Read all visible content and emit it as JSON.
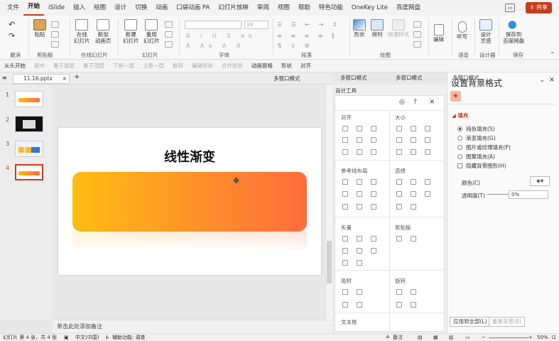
{
  "menu": {
    "items": [
      "文件",
      "开始",
      "iSlide",
      "插入",
      "绘图",
      "设计",
      "切换",
      "动画",
      "口袋动画 PA",
      "幻灯片放映",
      "审阅",
      "视图",
      "帮助",
      "特色功能",
      "OneKey Lite",
      "百度网盘"
    ],
    "share": "共享"
  },
  "ribbon": {
    "undo_label": "撤消",
    "paste": "粘贴",
    "clipboard": "剪贴板",
    "new_slide": "在线\n幻灯片",
    "new_anim": "新加\n动画页",
    "online_group": "在线幻灯片",
    "newslide": "新建\n幻灯片",
    "reuse": "重用\n幻灯片",
    "slides_group": "幻灯片",
    "font_size": "18",
    "font_group": "字体",
    "para_group": "段落",
    "shape": "形状",
    "arrange": "排列",
    "quick_style": "快速样式",
    "draw_group": "绘图",
    "edit": "编辑",
    "listen": "听写",
    "voice_group": "语音",
    "designer": "设计\n灵感",
    "designer_group": "设计器",
    "save_baidu": "保存到\n百度网盘",
    "save_group": "保存"
  },
  "quickbar": {
    "items": [
      {
        "label": "从头开始",
        "on": true
      },
      {
        "label": "居中",
        "on": false
      },
      {
        "label": "置于底层",
        "on": false
      },
      {
        "label": "置于顶层",
        "on": false
      },
      {
        "label": "下移一层",
        "on": false
      },
      {
        "label": "上移一层",
        "on": false
      },
      {
        "label": "旋转",
        "on": false
      },
      {
        "label": "编辑形状",
        "on": false
      },
      {
        "label": "合并形状",
        "on": false
      },
      {
        "label": "动画窗格",
        "on": true
      },
      {
        "label": "形状",
        "on": true
      },
      {
        "label": "对齐",
        "on": true
      }
    ]
  },
  "tabs": {
    "doc": "11.16.pptx",
    "win": [
      "多窗口模式",
      "多窗口模式",
      "多窗口模式",
      "多窗口模式"
    ]
  },
  "thumbs": [
    "1",
    "2",
    "3",
    "4"
  ],
  "slide": {
    "title": "线性渐变"
  },
  "notes": "单击此处添加备注",
  "dtool": {
    "title": "设计工具",
    "sections": [
      "对齐",
      "大小",
      "参考线布局",
      "选择",
      "矢量",
      "剪贴板",
      "吸附",
      "旋转",
      "文本框"
    ]
  },
  "fpane": {
    "title": "设置背景格式",
    "fill": "填充",
    "options": [
      "纯色填充(S)",
      "渐变填充(G)",
      "图片或纹理填充(P)",
      "图案填充(A)"
    ],
    "hide": "隐藏背景图形(H)",
    "color": "颜色(C)",
    "transparency": "透明度(T)",
    "trans_value": "0%",
    "apply_all": "应用到全部(L)",
    "reset": "重置背景(B)"
  },
  "status": {
    "slide": "幻灯片 第 4 张，共 4 张",
    "lang": "中文(中国)",
    "access": "辅助功能: 调查",
    "notes": "备注",
    "zoom": "50%"
  },
  "colors": {
    "accent": "#c43e1c",
    "grad_start": "#fdbd13",
    "grad_end": "#ff6b3d"
  }
}
